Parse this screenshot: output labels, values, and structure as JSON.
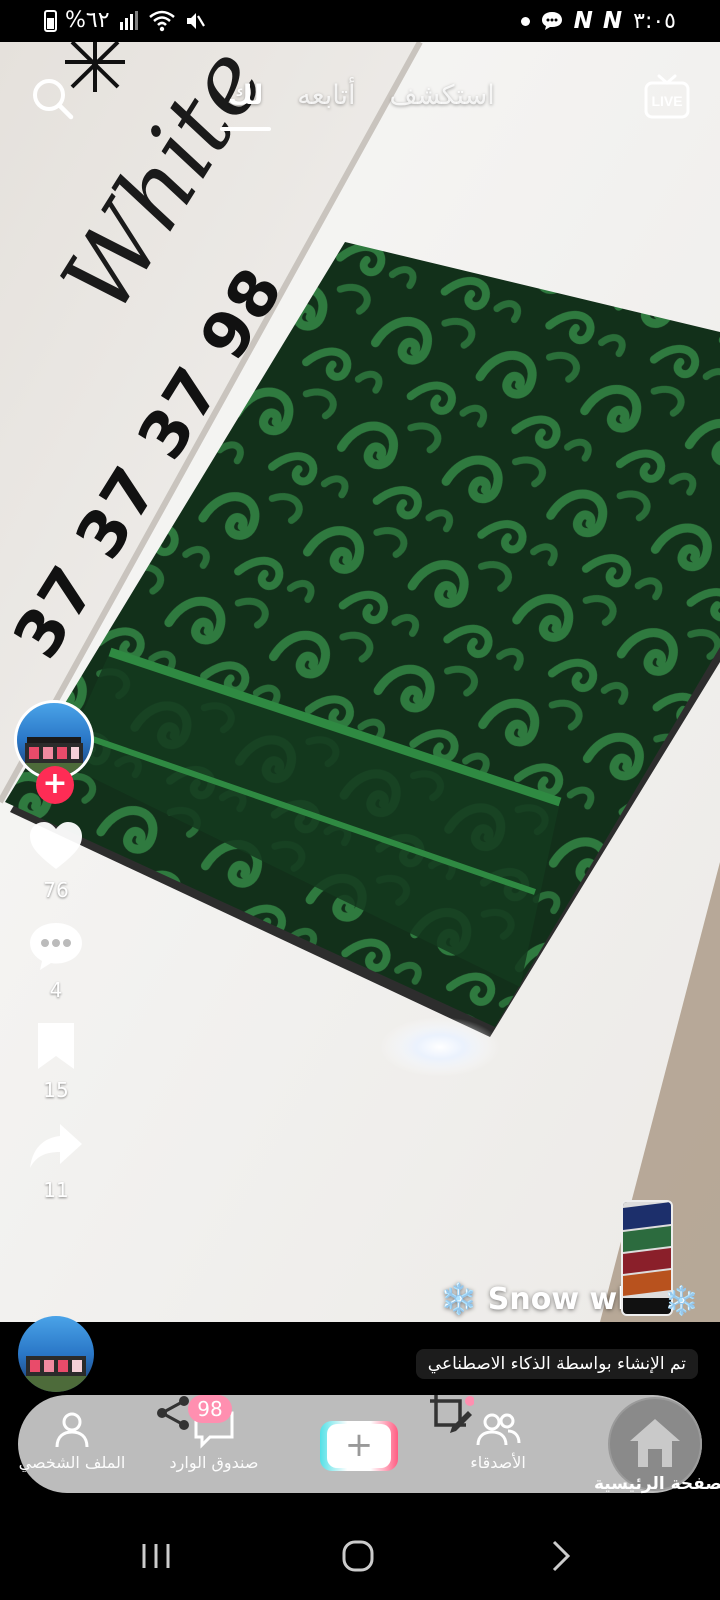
{
  "status_bar": {
    "time": "٣:٠٥",
    "battery_percent": "%٦٢",
    "carrier_marks": "N N",
    "icons": [
      "battery-icon",
      "signal-icon",
      "wifi-icon",
      "mute-icon",
      "chat-bubble-icon"
    ]
  },
  "top_nav": {
    "tabs": [
      {
        "label": "استكشف",
        "active": false
      },
      {
        "label": "أتابعه",
        "active": false
      },
      {
        "label": "لك",
        "active": true
      }
    ],
    "left_icon": "search-icon",
    "right_icon": "live-tv-icon",
    "live_text": "LIVE"
  },
  "video": {
    "wall_sign_script": "White",
    "wall_sign_number": "37 37 37 98",
    "wall_sign_number_left": "7"
  },
  "actions": {
    "likes": "76",
    "comments": "4",
    "saves": "15",
    "shares": "11"
  },
  "caption": {
    "text": "❄️ Snow wh",
    "trailing_emoji": "❄️"
  },
  "ai_label": "تم الإنشاء بواسطة الذكاء الاصطناعي",
  "bottom_nav": {
    "items": [
      {
        "label": "الملف الشخصي",
        "icon": "profile-icon"
      },
      {
        "label": "صندوق الوارد",
        "icon": "inbox-icon",
        "badge": "98"
      },
      {
        "label": "",
        "icon": "plus-icon"
      },
      {
        "label": "الأصدقاء",
        "icon": "friends-icon"
      },
      {
        "label": "الصفحة الرئيسية",
        "icon": "home-icon"
      }
    ]
  },
  "colors": {
    "accent_red": "#fe2c55",
    "fabric_green": "#1f5b2e",
    "nav_pill": "#c6c6c6"
  }
}
